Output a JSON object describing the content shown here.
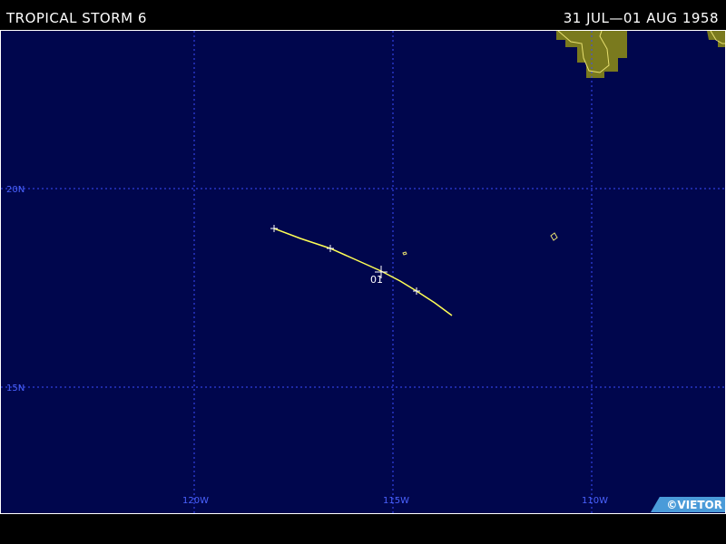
{
  "header": {
    "storm_title": "TROPICAL STORM 6",
    "date_range": "31 JUL—01 AUG 1958"
  },
  "map": {
    "latitude_labels": [
      "20N",
      "15N"
    ],
    "longitude_labels": [
      "120W",
      "115W",
      "110W"
    ],
    "track_point_label": "01",
    "colors": {
      "ocean": "#00064d",
      "land": "#7a7a1e",
      "coastline": "#e8e070",
      "grid": "#3a4cff",
      "track": "#ffff55"
    }
  },
  "credit": "©VIETOR"
}
